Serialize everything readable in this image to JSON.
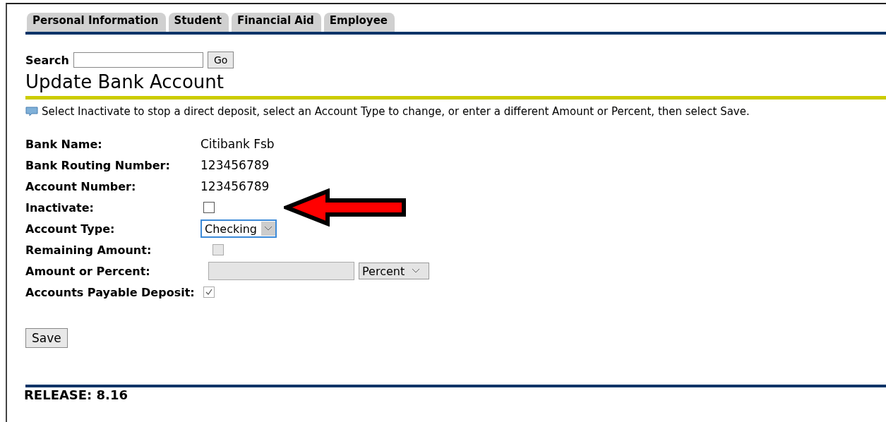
{
  "tabs": [
    {
      "label": "Personal Information",
      "selected": false
    },
    {
      "label": "Student",
      "selected": false
    },
    {
      "label": "Financial Aid",
      "selected": false
    },
    {
      "label": "Employee",
      "selected": false
    }
  ],
  "search": {
    "label": "Search",
    "button": "Go"
  },
  "page_title": "Update Bank Account",
  "info_text": "Select Inactivate to stop a direct deposit, select an Account Type to change, or enter a different Amount or Percent, then select Save.",
  "fields": [
    {
      "kind": "text",
      "label": "Bank Name:",
      "value": "Citibank Fsb"
    },
    {
      "kind": "text",
      "label": "Bank Routing Number:",
      "value": "123456789"
    },
    {
      "kind": "text",
      "label": "Account Number:",
      "value": "123456789"
    },
    {
      "kind": "checkbox",
      "label": "Inactivate:",
      "checked": false,
      "disabled": false,
      "pointed": true
    },
    {
      "kind": "select",
      "label": "Account Type:",
      "value": "Checking"
    },
    {
      "kind": "checkbox",
      "label": "Remaining Amount:",
      "checked": false,
      "disabled": true
    },
    {
      "kind": "amount",
      "label": "Amount or Percent:",
      "disabled": true,
      "unit": "Percent"
    },
    {
      "kind": "checkbox",
      "label": "Accounts Payable Deposit:",
      "checked": true,
      "disabled": true
    }
  ],
  "save_button": "Save",
  "release": "RELEASE: 8.16"
}
